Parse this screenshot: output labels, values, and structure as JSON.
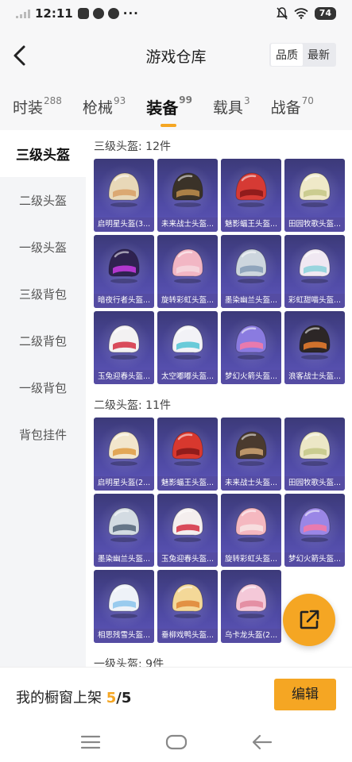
{
  "status_bar": {
    "time": "12:11",
    "dots": "···",
    "battery": "74"
  },
  "header": {
    "title": "游戏仓库",
    "sort_options": [
      "品质",
      "最新"
    ],
    "active_sort": "品质"
  },
  "categories": [
    {
      "label": "时装",
      "count": "288"
    },
    {
      "label": "枪械",
      "count": "93"
    },
    {
      "label": "装备",
      "count": "99",
      "active": true
    },
    {
      "label": "载具",
      "count": "3"
    },
    {
      "label": "战备",
      "count": "70"
    }
  ],
  "sidebar": [
    {
      "label": "三级头盔",
      "active": true
    },
    {
      "label": "二级头盔"
    },
    {
      "label": "一级头盔"
    },
    {
      "label": "三级背包"
    },
    {
      "label": "二级背包"
    },
    {
      "label": "一级背包"
    },
    {
      "label": "背包挂件"
    }
  ],
  "sections": [
    {
      "title": "三级头盔: 12件",
      "items": [
        {
          "name": "启明星头盔(3...",
          "color": "#e8d8b8",
          "accent": "#d9a36a"
        },
        {
          "name": "未来战士头盔...",
          "color": "#3a3228",
          "accent": "#b8884a"
        },
        {
          "name": "魅影蝠王头盔...",
          "color": "#d63a34",
          "accent": "#8a1a1a"
        },
        {
          "name": "田园牧歌头盔...",
          "color": "#efe9c8",
          "accent": "#c7c98a"
        },
        {
          "name": "暗夜行者头盔...",
          "color": "#2f2250",
          "accent": "#c13adb"
        },
        {
          "name": "旋转彩虹头盔...",
          "color": "#f2b6c4",
          "accent": "#f5d6de"
        },
        {
          "name": "墨染幽兰头盔...",
          "color": "#cdd6de",
          "accent": "#8aa0b8"
        },
        {
          "name": "彩虹甜喵头盔...",
          "color": "#f0e8f2",
          "accent": "#8fd3dc"
        },
        {
          "name": "玉兔迎春头盔...",
          "color": "#f3f1f2",
          "accent": "#d6384a"
        },
        {
          "name": "太空嘟嘟头盔...",
          "color": "#f2f2f6",
          "accent": "#5ac6d6"
        },
        {
          "name": "梦幻火箭头盔...",
          "color": "#8a7be0",
          "accent": "#f27aa8"
        },
        {
          "name": "浪客战士头盔...",
          "color": "#2c2626",
          "accent": "#e27a2e"
        }
      ]
    },
    {
      "title": "二级头盔: 11件",
      "items": [
        {
          "name": "启明星头盔(2...",
          "color": "#f2e6cc",
          "accent": "#e0a04a"
        },
        {
          "name": "魅影蝠王头盔...",
          "color": "#d8382e",
          "accent": "#8a1a1a"
        },
        {
          "name": "未来战士头盔...",
          "color": "#4a3a2e",
          "accent": "#c9a070"
        },
        {
          "name": "田园牧歌头盔...",
          "color": "#ece7c6",
          "accent": "#c7c98a"
        },
        {
          "name": "墨染幽兰头盔...",
          "color": "#d3dbe2",
          "accent": "#5a6a7e"
        },
        {
          "name": "玉兔迎春头盔...",
          "color": "#f4eeee",
          "accent": "#d6384a"
        },
        {
          "name": "旋转彩虹头盔...",
          "color": "#f5b8c0",
          "accent": "#f7e2e2"
        },
        {
          "name": "梦幻火箭头盔...",
          "color": "#9a86e6",
          "accent": "#f27aa8"
        },
        {
          "name": "相思残雪头盔...",
          "color": "#eef2f8",
          "accent": "#8fc6ec"
        },
        {
          "name": "垂柳戏鸭头盔...",
          "color": "#f4d898",
          "accent": "#e08a3a"
        },
        {
          "name": "乌卡龙头盔(2...",
          "color": "#f4c8d8",
          "accent": "#e2889e"
        }
      ]
    },
    {
      "title": "一级头盔: 9件",
      "items": []
    }
  ],
  "shelf": {
    "label": "我的橱窗上架",
    "current": "5",
    "total": "5"
  },
  "edit_button": "编辑",
  "colors": {
    "accent": "#f5a623",
    "card_bg": "#4a46a0"
  }
}
